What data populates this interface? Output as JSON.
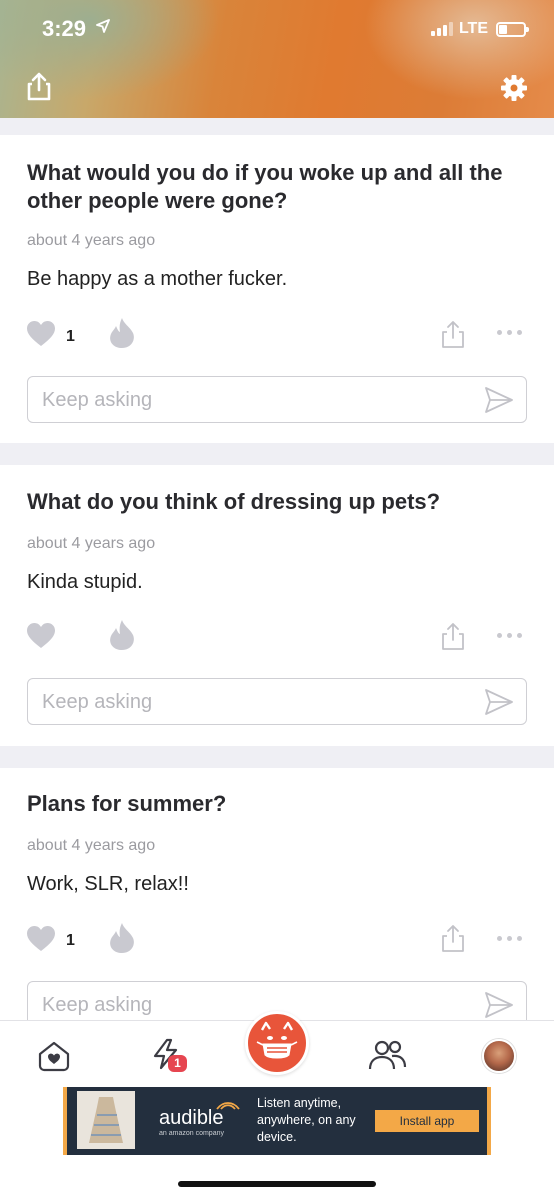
{
  "status_bar": {
    "time": "3:29",
    "network": "LTE"
  },
  "feed": [
    {
      "question": "What would you do if you woke up and all the other people were gone?",
      "time": "about 4 years ago",
      "answer": "Be happy as a mother fucker.",
      "likes": "1",
      "ask_placeholder": "Keep asking"
    },
    {
      "question": "What do you think of dressing up pets?",
      "time": "about 4 years ago",
      "answer": "Kinda stupid.",
      "likes": "",
      "ask_placeholder": "Keep asking"
    },
    {
      "question": "Plans for summer?",
      "time": "about 4 years ago",
      "answer": "Work, SLR, relax!!",
      "likes": "1",
      "ask_placeholder": "Keep asking"
    }
  ],
  "tabbar": {
    "notifications_badge": "1"
  },
  "ad": {
    "brand": "audible",
    "brand_sub": "an amazon company",
    "copy": "Listen anytime, anywhere, on any device.",
    "button": "Install app"
  },
  "colors": {
    "accent": "#e8553a",
    "ad_orange": "#f3a847",
    "ad_dark": "#232f3e"
  }
}
